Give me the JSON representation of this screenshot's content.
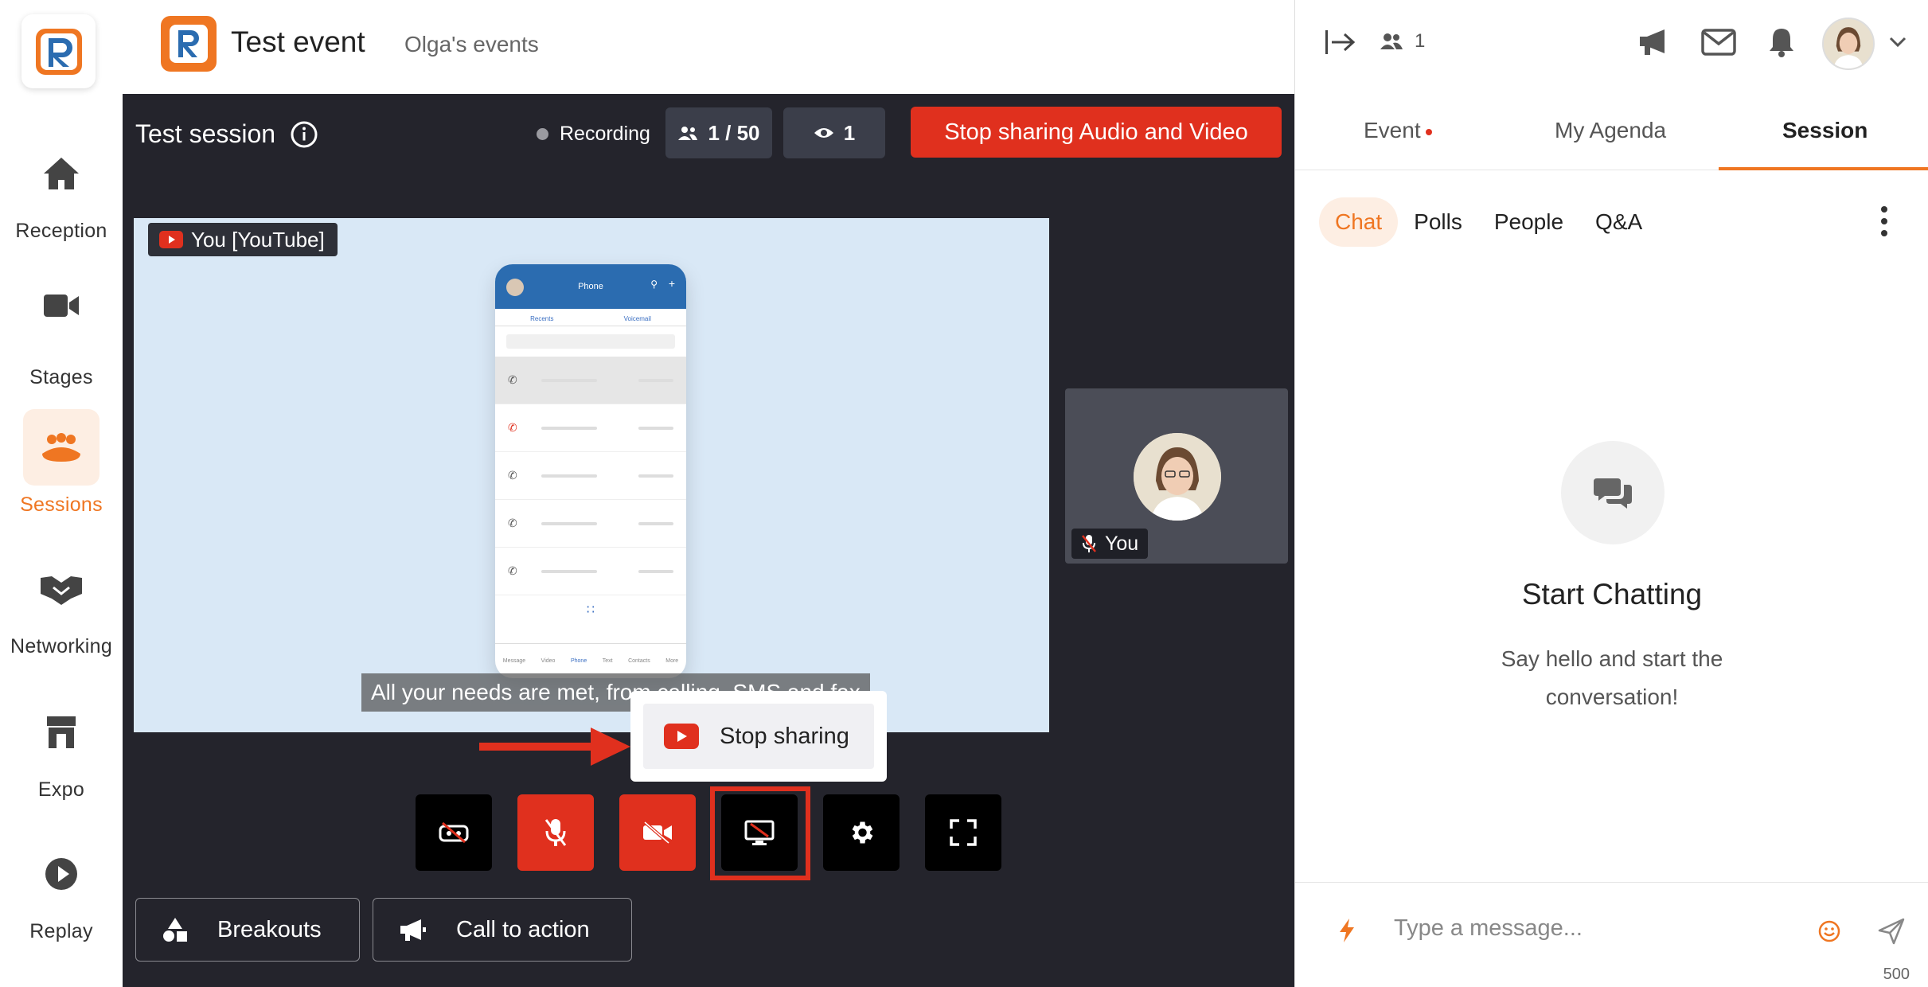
{
  "nav": {
    "items": [
      {
        "label": "Reception",
        "icon": "home-icon"
      },
      {
        "label": "Stages",
        "icon": "video-camera-icon"
      },
      {
        "label": "Sessions",
        "icon": "people-group-icon"
      },
      {
        "label": "Networking",
        "icon": "handshake-icon"
      },
      {
        "label": "Expo",
        "icon": "store-icon"
      },
      {
        "label": "Replay",
        "icon": "play-icon"
      }
    ],
    "active": "Sessions"
  },
  "header": {
    "event_title": "Test event",
    "organizer": "Olga's events"
  },
  "session": {
    "title": "Test session",
    "recording_label": "Recording",
    "attendees": "1 / 50",
    "viewers": "1",
    "stop_sharing_av": "Stop sharing Audio and Video"
  },
  "video": {
    "source_tag": "You [YouTube]",
    "caption": "All your needs are met, from calling, SMS and fax",
    "phone_title": "Phone",
    "phone_tabs": [
      "Recents",
      "Voicemail"
    ],
    "phone_bottom": [
      "Message",
      "Video",
      "Phone",
      "Text",
      "Contacts",
      "More"
    ]
  },
  "self_tile": {
    "label": "You"
  },
  "share_popup": {
    "stop_sharing": "Stop sharing"
  },
  "controls": [
    {
      "name": "toggle-background-button",
      "icon": "eye-off-icon"
    },
    {
      "name": "mute-mic-button",
      "icon": "mic-off-icon"
    },
    {
      "name": "stop-camera-button",
      "icon": "camera-off-icon"
    },
    {
      "name": "screen-share-button",
      "icon": "monitor-off-icon"
    },
    {
      "name": "settings-button",
      "icon": "gear-icon"
    },
    {
      "name": "fullscreen-button",
      "icon": "fullscreen-icon"
    }
  ],
  "bottom_actions": {
    "breakouts": "Breakouts",
    "call_to_action": "Call to action"
  },
  "right_panel": {
    "online_count": "1",
    "tabs": [
      "Event",
      "My Agenda",
      "Session"
    ],
    "active_tab": "Session",
    "subtabs": [
      "Chat",
      "Polls",
      "People",
      "Q&A"
    ],
    "active_subtab": "Chat",
    "empty_title": "Start Chatting",
    "empty_subtitle": "Say hello and start the conversation!",
    "message_placeholder": "Type a message...",
    "char_count": "500"
  },
  "colors": {
    "accent": "#ef7622",
    "danger": "#e0301e",
    "stage_bg": "#24242c"
  }
}
